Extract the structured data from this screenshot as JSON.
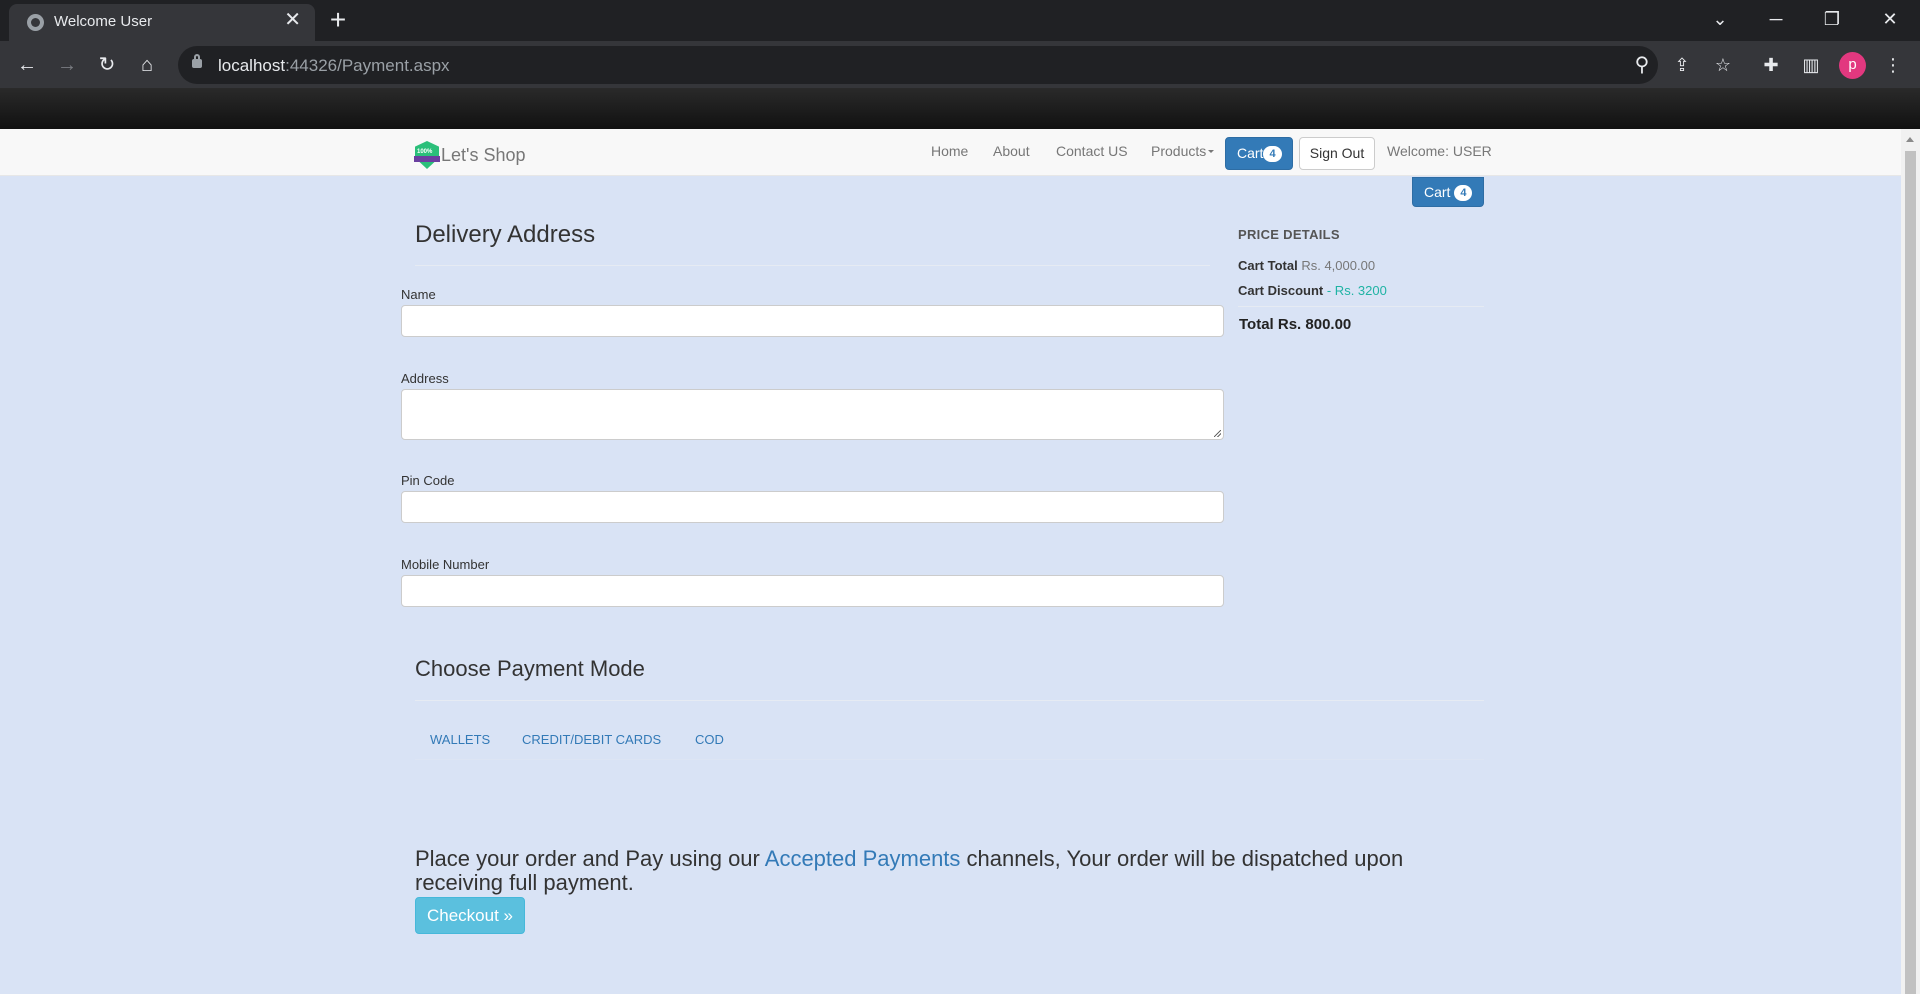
{
  "browser": {
    "tab_title": "Welcome User",
    "url_host": "localhost",
    "url_rest": ":44326/Payment.aspx",
    "profile_initial": "p"
  },
  "navbar": {
    "brand_logo_text": "100%",
    "brand_name": "Let's Shop",
    "links": [
      "Home",
      "About",
      "Contact US",
      "Products"
    ],
    "cart_label": "Cart",
    "cart_count": "4",
    "signout_label": "Sign Out",
    "welcome_text": "Welcome: USER"
  },
  "cart_float": {
    "label": "Cart",
    "count": "4"
  },
  "delivery": {
    "heading": "Delivery Address",
    "fields": {
      "name": {
        "label": "Name",
        "value": ""
      },
      "address": {
        "label": "Address",
        "value": ""
      },
      "pincode": {
        "label": "Pin Code",
        "value": ""
      },
      "mobile": {
        "label": "Mobile Number",
        "value": ""
      }
    }
  },
  "price_details": {
    "title": "PRICE DETAILS",
    "cart_total_label": "Cart Total",
    "cart_total_value": "Rs. 4,000.00",
    "cart_discount_label": "Cart Discount",
    "cart_discount_value": "- Rs. 3200",
    "total_text": "Total Rs. 800.00"
  },
  "payment": {
    "heading": "Choose Payment Mode",
    "tabs": [
      "WALLETS",
      "CREDIT/DEBIT CARDS",
      "COD"
    ]
  },
  "order": {
    "text_before": "Place your order and Pay using our ",
    "link_text": "Accepted Payments",
    "text_after": " channels, Your order will be dispatched upon receiving full payment.",
    "checkout_label": "Checkout »"
  },
  "colors": {
    "page_bg": "#d9e3f5",
    "primary": "#337ab7",
    "info": "#5bc0de",
    "discount_green": "#1fb3a4"
  }
}
